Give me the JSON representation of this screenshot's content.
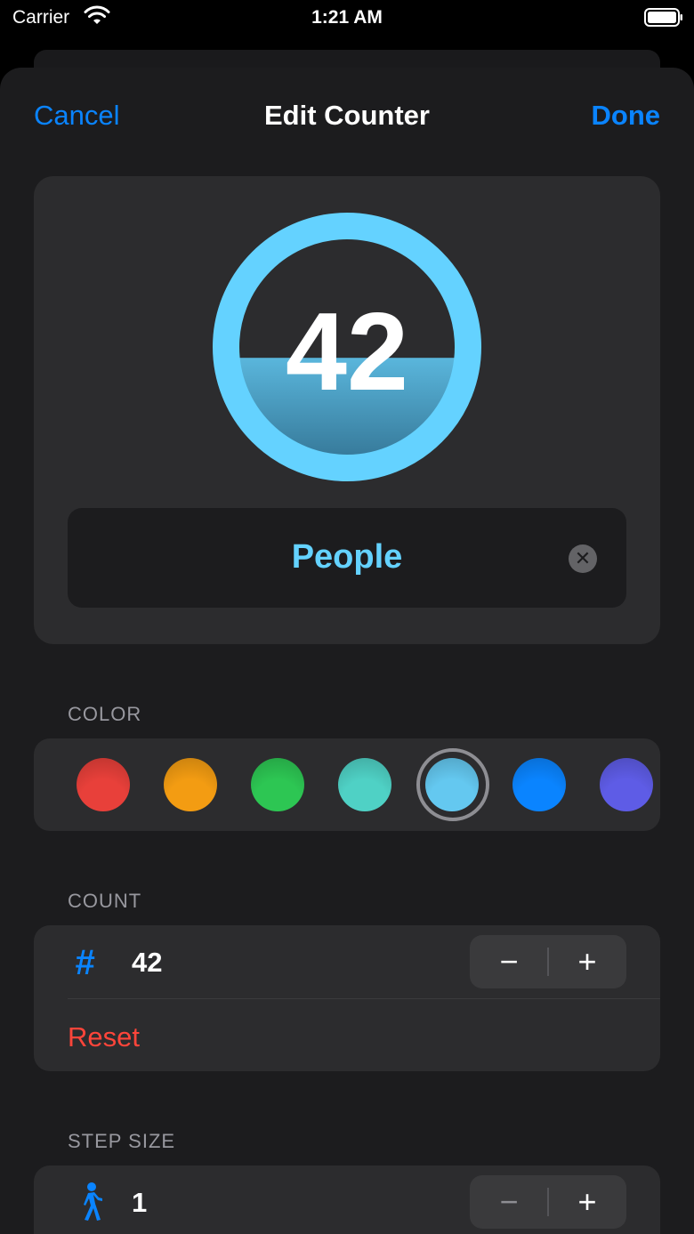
{
  "status_bar": {
    "carrier": "Carrier",
    "time": "1:21 AM"
  },
  "nav": {
    "cancel": "Cancel",
    "title": "Edit Counter",
    "done": "Done"
  },
  "preview": {
    "value": "42",
    "name": "People",
    "fill_fraction": 0.45
  },
  "sections": {
    "color": "COLOR",
    "count": "COUNT",
    "step_size": "STEP SIZE"
  },
  "colors": {
    "accent": "#0a84ff",
    "selected": "#64d2ff",
    "swatches": [
      {
        "name": "red",
        "hex": "#e8403a"
      },
      {
        "name": "orange",
        "hex": "#f39c12"
      },
      {
        "name": "green",
        "hex": "#2dc653"
      },
      {
        "name": "teal",
        "hex": "#4fd1c5"
      },
      {
        "name": "light-blue",
        "hex": "#64c8f0",
        "selected": true
      },
      {
        "name": "blue",
        "hex": "#0a84ff"
      },
      {
        "name": "indigo",
        "hex": "#5e5ce6"
      }
    ]
  },
  "count": {
    "value": "42",
    "reset": "Reset",
    "decrement": "−",
    "increment": "+"
  },
  "step": {
    "value": "1",
    "decrement": "−",
    "increment": "+"
  }
}
